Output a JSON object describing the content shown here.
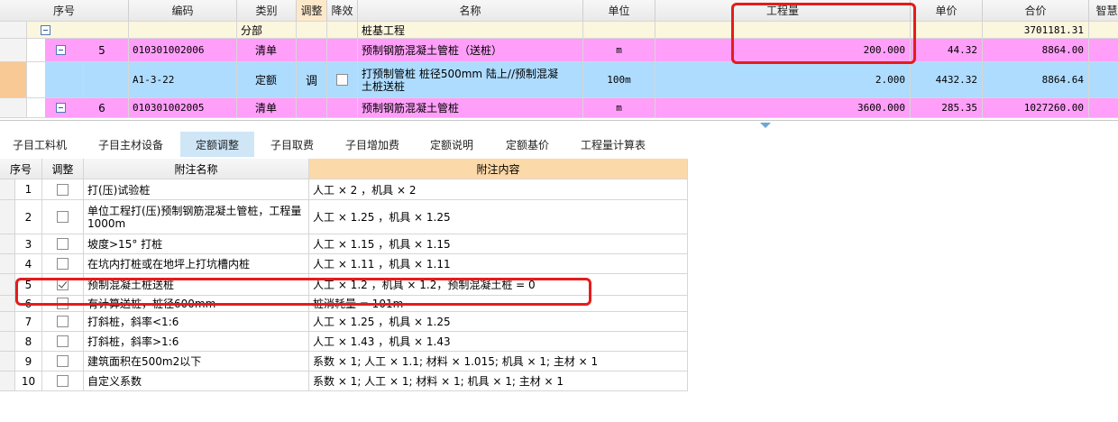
{
  "top_grid": {
    "headers": {
      "seq": "序号",
      "code": "编码",
      "category": "类别",
      "adjust": "调整",
      "reduce": "降效",
      "name": "名称",
      "unit": "单位",
      "quantity": "工程量",
      "unit_price": "单价",
      "total": "合价",
      "smart": "智慧"
    },
    "rows": [
      {
        "type": "fenbu",
        "seq": "",
        "code": "",
        "category": "分部",
        "adjust": "",
        "name": "桩基工程",
        "unit": "",
        "quantity": "",
        "unit_price": "",
        "total": "3701181.31"
      },
      {
        "type": "qingdan",
        "seq": "5",
        "code": "010301002006",
        "category": "清单",
        "adjust": "",
        "name": "预制钢筋混凝土管桩（送桩）",
        "unit": "m",
        "quantity": "200.000",
        "unit_price": "44.32",
        "total": "8864.00"
      },
      {
        "type": "dinge",
        "seq": "",
        "code": "A1-3-22",
        "category": "定额",
        "adjust": "调",
        "name": "打预制管桩 桩径500mm 陆上//预制混凝土桩送桩",
        "unit": "100m",
        "quantity": "2.000",
        "unit_price": "4432.32",
        "total": "8864.64"
      },
      {
        "type": "qingdan",
        "seq": "6",
        "code": "010301002005",
        "category": "清单",
        "adjust": "",
        "name": "预制钢筋混凝土管桩",
        "unit": "m",
        "quantity": "3600.000",
        "unit_price": "285.35",
        "total": "1027260.00"
      }
    ]
  },
  "tabs": [
    {
      "label": "子目工料机",
      "active": false
    },
    {
      "label": "子目主材设备",
      "active": false
    },
    {
      "label": "定额调整",
      "active": true
    },
    {
      "label": "子目取费",
      "active": false
    },
    {
      "label": "子目增加费",
      "active": false
    },
    {
      "label": "定额说明",
      "active": false
    },
    {
      "label": "定额基价",
      "active": false
    },
    {
      "label": "工程量计算表",
      "active": false
    }
  ],
  "bottom_grid": {
    "headers": {
      "seq": "序号",
      "adjust": "调整",
      "note_name": "附注名称",
      "note_content": "附注内容"
    },
    "rows": [
      {
        "seq": "1",
        "checked": false,
        "name": "打(压)试验桩",
        "content": "人工 × 2 ，机具 × 2"
      },
      {
        "seq": "2",
        "checked": false,
        "name": "单位工程打(压)预制钢筋混凝土管桩，工程量1000m",
        "content": "人工 × 1.25 ，机具 × 1.25"
      },
      {
        "seq": "3",
        "checked": false,
        "name": "坡度>15° 打桩",
        "content": "人工 × 1.15 ，机具 × 1.15"
      },
      {
        "seq": "4",
        "checked": false,
        "name": "在坑内打桩或在地坪上打坑槽内桩",
        "content": "人工 × 1.11 ，机具 × 1.11"
      },
      {
        "seq": "5",
        "checked": true,
        "name": "预制混凝土桩送桩",
        "content": "人工 × 1.2 ，机具 × 1.2，预制混凝土桩 = 0"
      },
      {
        "seq": "6",
        "checked": false,
        "name": "有计算送桩，桩径600mm",
        "content": "桩消耗量 = 101m"
      },
      {
        "seq": "7",
        "checked": false,
        "name": "打斜桩，斜率<1:6",
        "content": "人工 × 1.25 ，机具 × 1.25"
      },
      {
        "seq": "8",
        "checked": false,
        "name": "打斜桩，斜率>1:6",
        "content": "人工 × 1.43 ，机具 × 1.43"
      },
      {
        "seq": "9",
        "checked": false,
        "name": "建筑面积在500m2以下",
        "content": "系数 × 1; 人工 × 1.1; 材料 × 1.015; 机具 × 1; 主材 × 1"
      },
      {
        "seq": "10",
        "checked": false,
        "name": "自定义系数",
        "content": "系数 × 1; 人工 × 1; 材料 × 1; 机具 × 1; 主材 × 1"
      }
    ]
  },
  "colors": {
    "fenbu_row": "#fbf6de",
    "qingdan_row": "#ff9ff9",
    "dinge_row": "#aedcff",
    "active_tab": "#cfe6f7",
    "header_highlight": "#fcd9a8",
    "annotation": "#e51c1c"
  },
  "icons": [
    "tree-collapse-icon",
    "checkbox-icon",
    "splitter-arrow-icon"
  ]
}
